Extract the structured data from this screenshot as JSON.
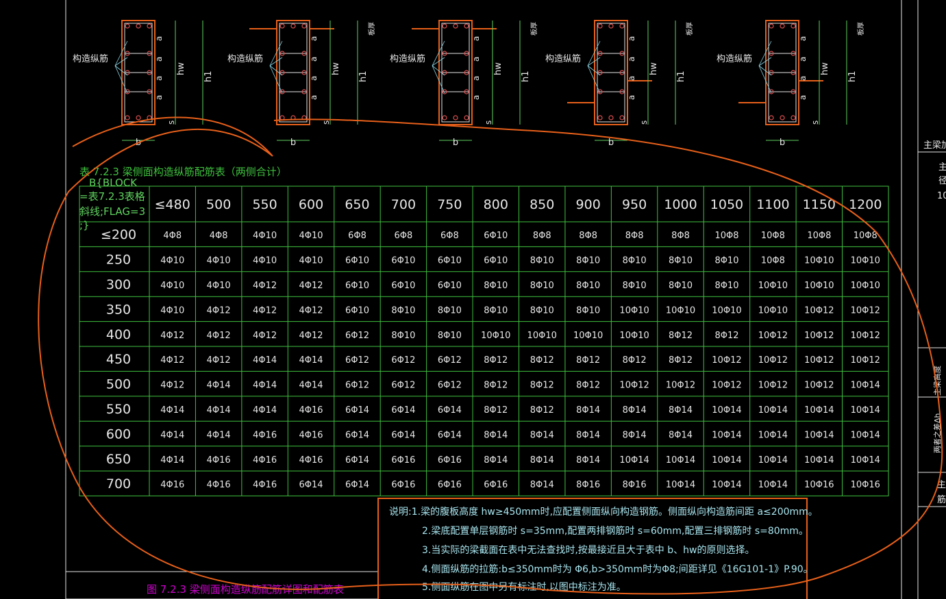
{
  "table": {
    "title": "表 7.2.3   梁侧面构造纵筋配筋表（两侧合计）",
    "block_note": [
      "B{BLOCK",
      "=表7.2.3表格",
      "斜线;FLAG=3",
      ";}"
    ],
    "col_headers": [
      "≤480",
      "500",
      "550",
      "600",
      "650",
      "700",
      "750",
      "800",
      "850",
      "900",
      "950",
      "1000",
      "1050",
      "1100",
      "1150",
      "1200"
    ],
    "rows": [
      {
        "h": "≤200",
        "c": [
          "4Φ8",
          "4Φ8",
          "4Φ10",
          "4Φ10",
          "6Φ8",
          "6Φ8",
          "6Φ8",
          "6Φ10",
          "8Φ8",
          "8Φ8",
          "8Φ8",
          "8Φ8",
          "10Φ8",
          "10Φ8",
          "10Φ8",
          "10Φ8"
        ]
      },
      {
        "h": "250",
        "c": [
          "4Φ10",
          "4Φ10",
          "4Φ10",
          "4Φ10",
          "6Φ10",
          "6Φ10",
          "6Φ10",
          "6Φ10",
          "8Φ10",
          "8Φ10",
          "8Φ10",
          "8Φ10",
          "8Φ10",
          "10Φ8",
          "10Φ10",
          "10Φ10"
        ]
      },
      {
        "h": "300",
        "c": [
          "4Φ10",
          "4Φ10",
          "4Φ12",
          "4Φ12",
          "6Φ10",
          "6Φ10",
          "6Φ10",
          "8Φ10",
          "8Φ10",
          "8Φ10",
          "8Φ10",
          "8Φ10",
          "8Φ10",
          "10Φ10",
          "10Φ10",
          "10Φ10"
        ]
      },
      {
        "h": "350",
        "c": [
          "4Φ10",
          "4Φ12",
          "4Φ12",
          "4Φ12",
          "6Φ10",
          "8Φ10",
          "8Φ10",
          "8Φ10",
          "8Φ10",
          "8Φ10",
          "10Φ10",
          "10Φ10",
          "10Φ10",
          "10Φ10",
          "10Φ12",
          "10Φ12"
        ]
      },
      {
        "h": "400",
        "c": [
          "4Φ12",
          "4Φ12",
          "4Φ12",
          "4Φ12",
          "6Φ12",
          "8Φ10",
          "8Φ10",
          "10Φ10",
          "10Φ10",
          "10Φ10",
          "10Φ10",
          "8Φ12",
          "8Φ12",
          "10Φ12",
          "10Φ12",
          "10Φ12"
        ]
      },
      {
        "h": "450",
        "c": [
          "4Φ12",
          "4Φ12",
          "4Φ14",
          "4Φ14",
          "6Φ12",
          "6Φ12",
          "6Φ12",
          "8Φ12",
          "8Φ12",
          "8Φ12",
          "8Φ12",
          "8Φ12",
          "10Φ12",
          "10Φ12",
          "10Φ12",
          "10Φ12"
        ]
      },
      {
        "h": "500",
        "c": [
          "4Φ12",
          "4Φ14",
          "4Φ14",
          "4Φ14",
          "6Φ12",
          "6Φ12",
          "6Φ12",
          "8Φ12",
          "8Φ12",
          "8Φ12",
          "10Φ12",
          "10Φ12",
          "10Φ12",
          "10Φ12",
          "10Φ12",
          "10Φ14"
        ]
      },
      {
        "h": "550",
        "c": [
          "4Φ14",
          "4Φ14",
          "4Φ14",
          "4Φ16",
          "6Φ14",
          "6Φ14",
          "6Φ14",
          "8Φ12",
          "8Φ12",
          "8Φ14",
          "8Φ14",
          "8Φ14",
          "10Φ14",
          "10Φ14",
          "10Φ14",
          "10Φ14"
        ]
      },
      {
        "h": "600",
        "c": [
          "4Φ14",
          "4Φ14",
          "4Φ16",
          "4Φ16",
          "6Φ14",
          "6Φ14",
          "6Φ14",
          "8Φ14",
          "8Φ14",
          "8Φ14",
          "8Φ14",
          "8Φ14",
          "10Φ14",
          "10Φ14",
          "10Φ14",
          "10Φ14"
        ]
      },
      {
        "h": "650",
        "c": [
          "4Φ14",
          "4Φ16",
          "4Φ16",
          "4Φ16",
          "6Φ14",
          "6Φ16",
          "6Φ16",
          "8Φ14",
          "8Φ14",
          "8Φ14",
          "10Φ14",
          "10Φ14",
          "10Φ14",
          "10Φ14",
          "10Φ14",
          "10Φ14"
        ]
      },
      {
        "h": "700",
        "c": [
          "4Φ16",
          "4Φ16",
          "4Φ16",
          "6Φ14",
          "6Φ14",
          "6Φ16",
          "6Φ16",
          "6Φ16",
          "8Φ14",
          "8Φ16",
          "8Φ16",
          "10Φ14",
          "10Φ14",
          "10Φ14",
          "10Φ16",
          "10Φ16"
        ]
      }
    ]
  },
  "notes": [
    "说明:1.梁的腹板高度 hw≥450mm时,应配置侧面纵向构造钢筋。侧面纵向构造筋间距 a≤200mm。",
    "2.梁底配置单层钢筋时 s=35mm,配置两排钢筋时 s=60mm,配置三排钢筋时 s=80mm。",
    "3.当实际的梁截面在表中无法查找时,按最接近且大于表中 b、hw的原则选择。",
    "4.侧面纵筋的拉筋:b≤350mm时为 Φ6,b>350mm时为Φ8;间距详见《16G101-1》P.90。",
    "5.侧面纵筋在图中另有标注时,以图中标注为准。"
  ],
  "figure_caption": "图 7.2.3   梁侧面构造纵筋配筋详图和配筋表",
  "diagram_labels": {
    "rebar": "构造纵筋",
    "b": "b",
    "hw": "hw",
    "h1": "h1",
    "a": "a",
    "s": "s",
    "slab": "板厚"
  },
  "right_panel": {
    "top_label": "主梁加",
    "mid_labels": [
      "主",
      "径",
      "10"
    ],
    "vert1": "主梁高度",
    "vert2": "两者之差Δh",
    "bottom_labels": [
      "主",
      "筋"
    ]
  },
  "colors": {
    "background": "#000000",
    "grid": "#3fc23f",
    "text_white": "#e8e8e8",
    "notes_text": "#a9e6f0",
    "caption": "#d100d1",
    "annotation": "#e8601a",
    "beam": "#e8601a",
    "frame": "#e8e8e8"
  }
}
